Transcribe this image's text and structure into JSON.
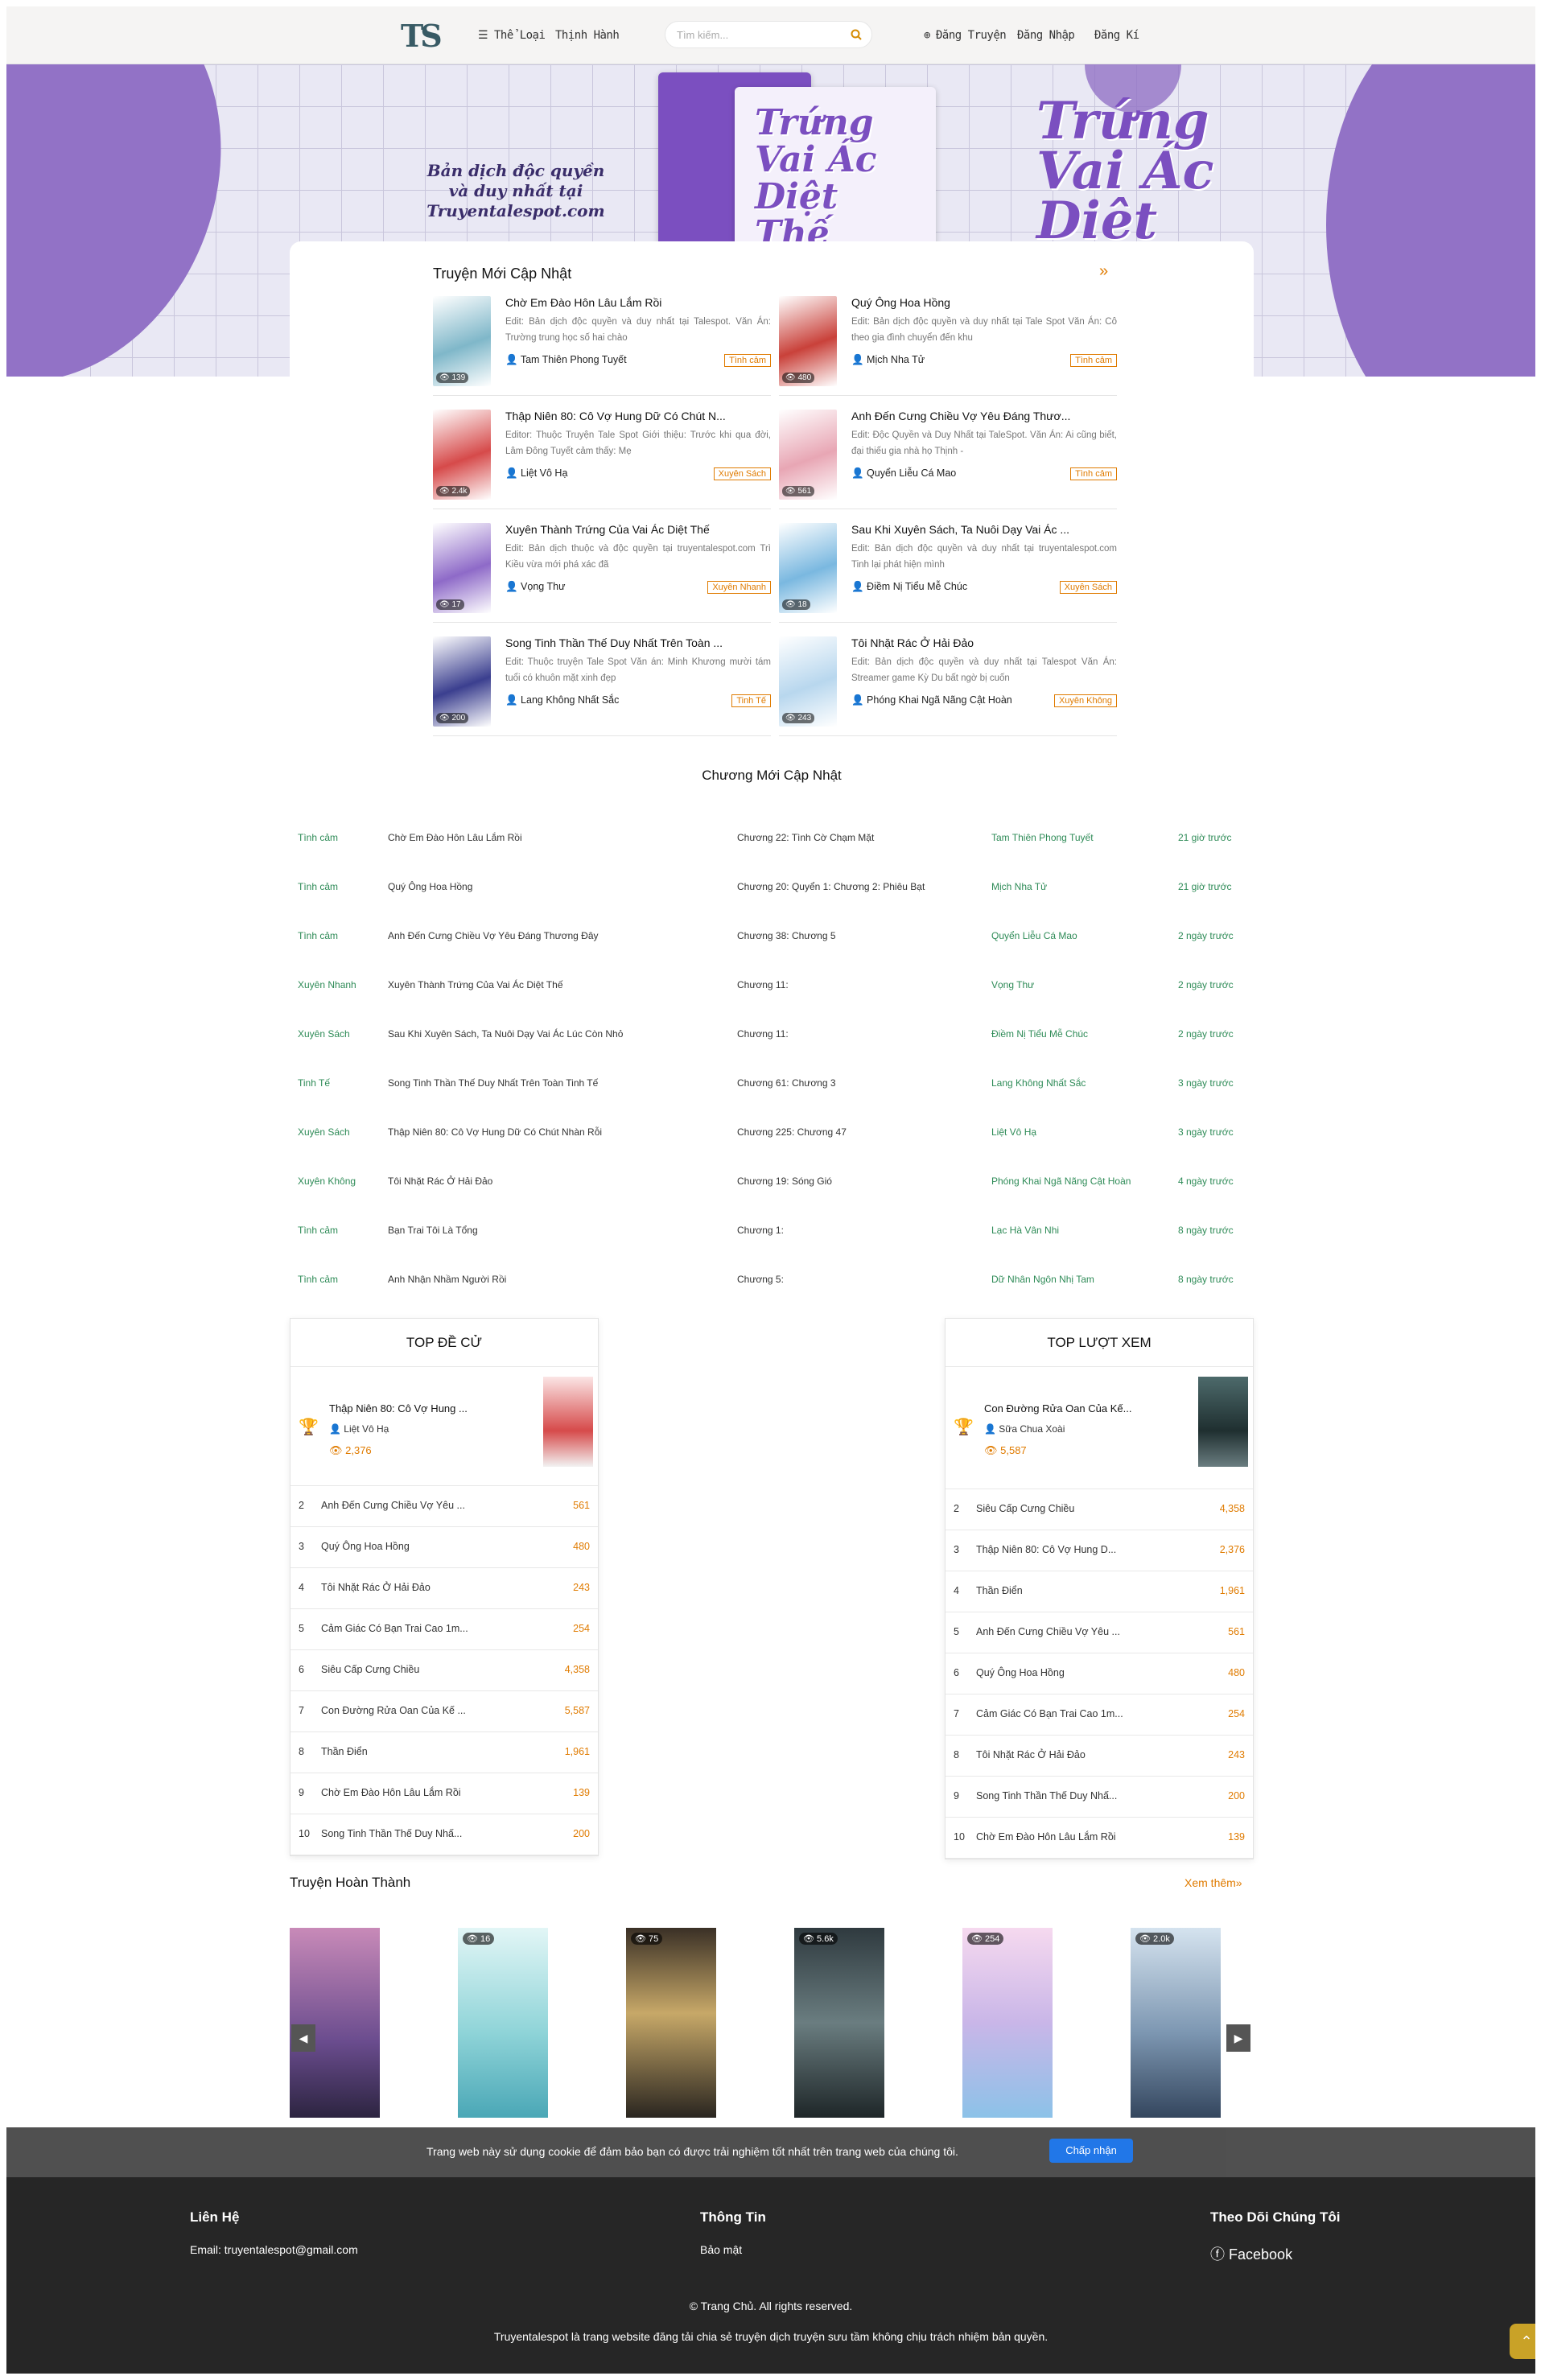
{
  "header": {
    "logo": "TS",
    "nav": {
      "genres": "☰ Thể Loại",
      "trending": "Thịnh Hành"
    },
    "search_placeholder": "Tìm kiếm...",
    "post": "Đăng Truyện",
    "login": "Đăng Nhập",
    "register": "Đăng Kí"
  },
  "banner": {
    "text": "Bản dịch độc quyền và duy nhất tại Truyentalespot.com",
    "title": "Trứng Vai Ác Diệt Thế"
  },
  "new_updates": {
    "title": "Truyện Mới Cập Nhật",
    "more_icon": "»",
    "stories": [
      {
        "title": "Chờ Em Đào Hôn Lâu Lắm Rồi",
        "desc": "Edit: Bản dịch độc quyền và duy nhất tại Talespot. Văn Án: Trường trung học số hai chào",
        "author": "Tam Thiên Phong Tuyết",
        "tag": "Tình cảm",
        "views": "139",
        "color": "#7fb7c9"
      },
      {
        "title": "Quý Ông Hoa Hồng",
        "desc": "Edit: Bản dịch độc quyền và duy nhất tại Tale Spot Văn Án: Cô theo gia đình chuyển đến khu",
        "author": "Mịch Nha Tử",
        "tag": "Tình cảm",
        "views": "480",
        "color": "#c9413a"
      },
      {
        "title": "Thập Niên 80: Cô Vợ Hung Dữ Có Chút N...",
        "desc": "Editor: Thuộc Truyện Tale Spot Giới thiệu: Trước khi qua đời, Lâm Đông Tuyết cảm thấy: Mẹ",
        "author": "Liệt Vô Hạ",
        "tag": "Xuyên Sách",
        "views": "2.4k",
        "color": "#d64a4a"
      },
      {
        "title": "Anh Đến Cưng Chiều Vợ Yêu Đáng Thươ...",
        "desc": "Edit: Độc Quyền và Duy Nhất tại TaleSpot. Văn Án: Ai cũng biết, đại thiếu gia nhà họ Thịnh -",
        "author": "Quyển Liễu Cá Mao",
        "tag": "Tình cảm",
        "views": "561",
        "color": "#e8a6b4"
      },
      {
        "title": "Xuyên Thành Trứng Của Vai Ác Diệt Thế",
        "desc": "Edit: Bản dịch thuộc và độc quyền tại truyentalespot.com Trì Kiều vừa mới phá xác đã",
        "author": "Vọng Thư",
        "tag": "Xuyên Nhanh",
        "views": "17",
        "color": "#8e6ac8"
      },
      {
        "title": "Sau Khi Xuyên Sách, Ta Nuôi Dạy Vai Ác ...",
        "desc": "Edit: Bản dịch độc quyền và duy nhất tại truyentalespot.com Tinh lại phát hiện mình",
        "author": "Điềm Nị Tiểu Mễ Chúc",
        "tag": "Xuyên Sách",
        "views": "18",
        "color": "#7ab8e0"
      },
      {
        "title": "Song Tinh Thần Thế Duy Nhất Trên Toàn ...",
        "desc": "Edit: Thuộc truyện Tale Spot Văn án: Minh Khương mười tám tuổi có khuôn mặt xinh đẹp",
        "author": "Lang Không Nhất Sắc",
        "tag": "Tinh Tế",
        "views": "200",
        "color": "#3b3f8f"
      },
      {
        "title": "Tôi Nhặt Rác Ở Hải Đảo",
        "desc": "Edit: Bản dịch độc quyền và duy nhất tại Talespot Văn Án: Streamer game Kỳ Du bất ngờ bị cuốn",
        "author": "Phóng Khai Ngã Nãng Cật Hoàn",
        "tag": "Xuyên Không",
        "views": "243",
        "color": "#b8d7ee"
      }
    ]
  },
  "chapters": {
    "title": "Chương Mới Cập Nhật",
    "rows": [
      {
        "genre": "Tình cảm",
        "name": "Chờ Em Đào Hôn Lâu Lắm Rồi",
        "chapter": "Chương 22: Tình Cờ Chạm Mặt",
        "author": "Tam Thiên Phong Tuyết",
        "time": "21 giờ trước"
      },
      {
        "genre": "Tình cảm",
        "name": "Quý Ông Hoa Hồng",
        "chapter": "Chương 20: Quyển 1: Chương 2: Phiêu Bạt",
        "author": "Mịch Nha Tử",
        "time": "21 giờ trước"
      },
      {
        "genre": "Tình cảm",
        "name": "Anh Đến Cưng Chiều Vợ Yêu Đáng Thương Đây",
        "chapter": "Chương 38: Chương 5",
        "author": "Quyển Liễu Cá Mao",
        "time": "2 ngày trước"
      },
      {
        "genre": "Xuyên Nhanh",
        "name": "Xuyên Thành Trứng Của Vai Ác Diệt Thế",
        "chapter": "Chương 11:",
        "author": "Vọng Thư",
        "time": "2 ngày trước"
      },
      {
        "genre": "Xuyên Sách",
        "name": "Sau Khi Xuyên Sách, Ta Nuôi Dạy Vai Ác Lúc Còn Nhỏ",
        "chapter": "Chương 11:",
        "author": "Điềm Nị Tiểu Mễ Chúc",
        "time": "2 ngày trước"
      },
      {
        "genre": "Tinh Tế",
        "name": "Song Tinh Thần Thế Duy Nhất Trên Toàn Tinh Tế",
        "chapter": "Chương 61: Chương 3",
        "author": "Lang Không Nhất Sắc",
        "time": "3 ngày trước"
      },
      {
        "genre": "Xuyên Sách",
        "name": "Thập Niên 80: Cô Vợ Hung Dữ Có Chút Nhàn Rỗi",
        "chapter": "Chương 225: Chương 47",
        "author": "Liệt Vô Hạ",
        "time": "3 ngày trước"
      },
      {
        "genre": "Xuyên Không",
        "name": "Tôi Nhặt Rác Ở Hải Đảo",
        "chapter": "Chương 19: Sóng Gió",
        "author": "Phóng Khai Ngã Nãng Cật Hoàn",
        "time": "4 ngày trước"
      },
      {
        "genre": "Tình cảm",
        "name": "Bạn Trai Tôi Là Tổng",
        "chapter": "Chương 1:",
        "author": "Lạc Hà Vân Nhi",
        "time": "8 ngày trước"
      },
      {
        "genre": "Tình cảm",
        "name": "Anh Nhận Nhầm Người Rồi",
        "chapter": "Chương 5:",
        "author": "Dữ Nhân Ngôn Nhị Tam",
        "time": "8 ngày trước"
      }
    ]
  },
  "top_recommend": {
    "title": "TOP ĐỀ CỬ",
    "first": {
      "title": "Thập Niên 80: Cô Vợ Hung ...",
      "author": "Liệt Vô Hạ",
      "views": "2,376"
    },
    "rows": [
      {
        "n": "2",
        "t": "Anh Đến Cưng Chiều Vợ Yêu ...",
        "v": "561"
      },
      {
        "n": "3",
        "t": "Quý Ông Hoa Hồng",
        "v": "480"
      },
      {
        "n": "4",
        "t": "Tôi Nhặt Rác Ở Hải Đảo",
        "v": "243"
      },
      {
        "n": "5",
        "t": "Cảm Giác Có Bạn Trai Cao 1m...",
        "v": "254"
      },
      {
        "n": "6",
        "t": "Siêu Cấp Cưng Chiều",
        "v": "4,358"
      },
      {
        "n": "7",
        "t": "Con Đường Rửa Oan Của Kế ...",
        "v": "5,587"
      },
      {
        "n": "8",
        "t": "Thần Điển",
        "v": "1,961"
      },
      {
        "n": "9",
        "t": "Chờ Em Đào Hôn Lâu Lắm Rồi",
        "v": "139"
      },
      {
        "n": "10",
        "t": "Song Tinh Thần Thế Duy Nhấ...",
        "v": "200"
      }
    ]
  },
  "top_views": {
    "title": "TOP LƯỢT XEM",
    "first": {
      "title": "Con Đường Rửa Oan Của Kế...",
      "author": "Sữa Chua Xoài",
      "views": "5,587"
    },
    "rows": [
      {
        "n": "2",
        "t": "Siêu Cấp Cưng Chiều",
        "v": "4,358"
      },
      {
        "n": "3",
        "t": "Thập Niên 80: Cô Vợ Hung D...",
        "v": "2,376"
      },
      {
        "n": "4",
        "t": "Thần Điển",
        "v": "1,961"
      },
      {
        "n": "5",
        "t": "Anh Đến Cưng Chiều Vợ Yêu ...",
        "v": "561"
      },
      {
        "n": "6",
        "t": "Quý Ông Hoa Hồng",
        "v": "480"
      },
      {
        "n": "7",
        "t": "Cảm Giác Có Bạn Trai Cao 1m...",
        "v": "254"
      },
      {
        "n": "8",
        "t": "Tôi Nhặt Rác Ở Hải Đảo",
        "v": "243"
      },
      {
        "n": "9",
        "t": "Song Tinh Thần Thế Duy Nhấ...",
        "v": "200"
      },
      {
        "n": "10",
        "t": "Chờ Em Đào Hôn Lâu Lắm Rồi",
        "v": "139"
      }
    ]
  },
  "completed": {
    "title": "Truyện Hoàn Thành",
    "more": "Xem thêm»",
    "items": [
      {
        "views": "",
        "bg": "linear-gradient(#c88ab8,#6a4c8e 60%,#2c2440)"
      },
      {
        "views": "16",
        "bg": "linear-gradient(#e2f6f6,#8fd4d8 55%,#4aa7b6)"
      },
      {
        "views": "75",
        "bg": "linear-gradient(#3a3026,#c7a868 45%,#2a2620)"
      },
      {
        "views": "5.6k",
        "bg": "linear-gradient(#2f3a3f,#6a7d80 50%,#1e2628)"
      },
      {
        "views": "254",
        "bg": "linear-gradient(#f6d9ef,#c9b6e8 50%,#8cc2e8)"
      },
      {
        "views": "2.0k",
        "bg": "linear-gradient(#d5e3ef,#7d97b2 55%,#34465e)"
      }
    ]
  },
  "cookie": {
    "text": "Trang web này sử dụng cookie để đảm bảo bạn có được trải nghiệm tốt nhất trên trang web của chúng tôi.",
    "button": "Chấp nhận"
  },
  "footer": {
    "contact_title": "Liên Hệ",
    "contact_email": "Email: truyentalespot@gmail.com",
    "info_title": "Thông Tin",
    "info_link": "Bảo mật",
    "follow_title": "Theo Dõi Chúng Tôi",
    "facebook": "Facebook",
    "copyright": "© Trang Chủ. All rights reserved.",
    "disclaimer": "Truyentalespot là trang website đăng tải chia sẻ truyện dịch truyện sưu tầm không chịu trách nhiệm bản quyền."
  }
}
